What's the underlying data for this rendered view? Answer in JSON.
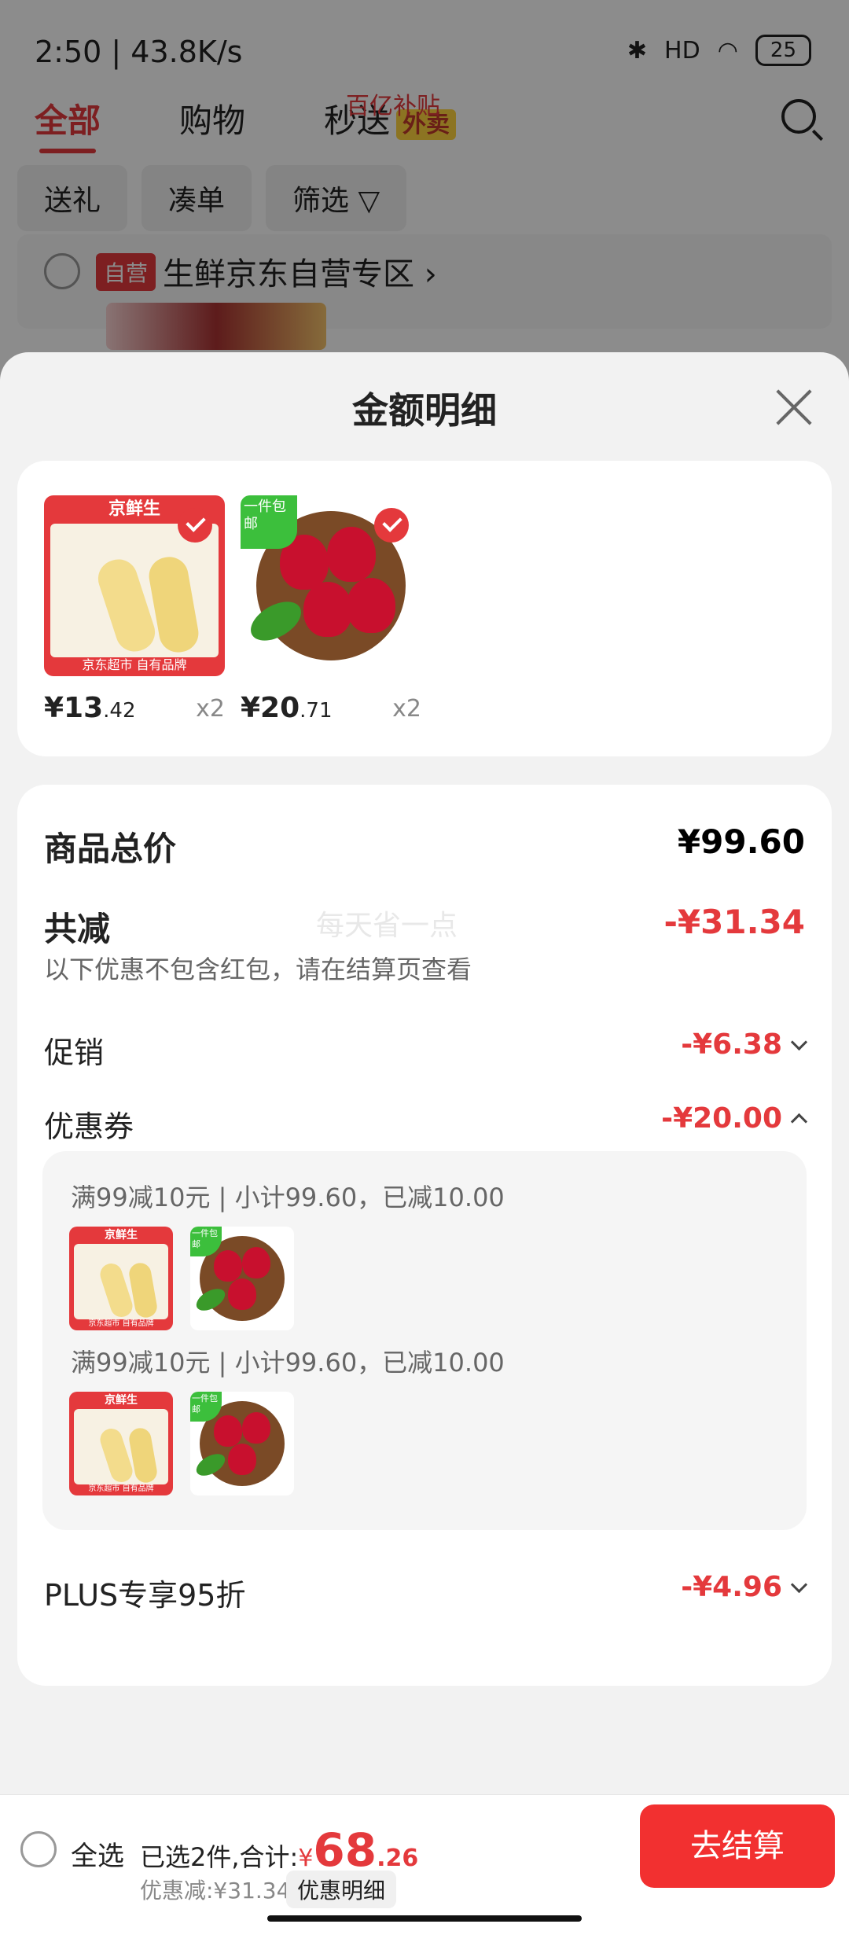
{
  "status_bar": {
    "time": "2:50 | 43.8K/s",
    "signal": "HD",
    "battery": "25"
  },
  "cart_tabs": [
    {
      "label": "全部"
    },
    {
      "label": "购物"
    },
    {
      "label": "秒送",
      "badge": "外卖"
    }
  ],
  "filter_chips": [
    "送礼",
    "凑单",
    "筛选 ▽"
  ],
  "shop": {
    "tag": "自营",
    "name": "生鲜京东自营专区 ›",
    "subsidy": "百亿补贴"
  },
  "sheet": {
    "title": "金额明细",
    "products": [
      {
        "price_int": "¥13",
        "price_dec": ".42",
        "qty": "x2",
        "brand": "京鲜生",
        "foot": "京东超市 自有品牌"
      },
      {
        "price_int": "¥20",
        "price_dec": ".71",
        "qty": "x2",
        "badge": "一件包邮"
      }
    ],
    "summary": {
      "total_label": "商品总价",
      "total_value": "¥99.60",
      "reduce_label": "共减",
      "reduce_value": "-¥31.34",
      "watermark": "每天省一点",
      "note": "以下优惠不包含红包，请在结算页查看",
      "promo_label": "促销",
      "promo_value": "-¥6.38",
      "coupon_label": "优惠券",
      "coupon_value": "-¥20.00",
      "coupon_lines": [
        "满99减10元 | 小计99.60，已减10.00",
        "满99减10元 | 小计99.60，已减10.00"
      ],
      "plus_label": "PLUS专享95折",
      "plus_value": "-¥4.96"
    }
  },
  "bottom_bar": {
    "select_all": "全选",
    "selected_text": "已选2件,合计:",
    "yen": "¥",
    "total_int": "68",
    "total_dec": ".26",
    "discount_text": "优惠减:¥31.34",
    "detail_button": "优惠明细",
    "checkout_button": "去结算"
  },
  "colors": {
    "accent": "#e4393c",
    "checkout": "#f23030"
  }
}
